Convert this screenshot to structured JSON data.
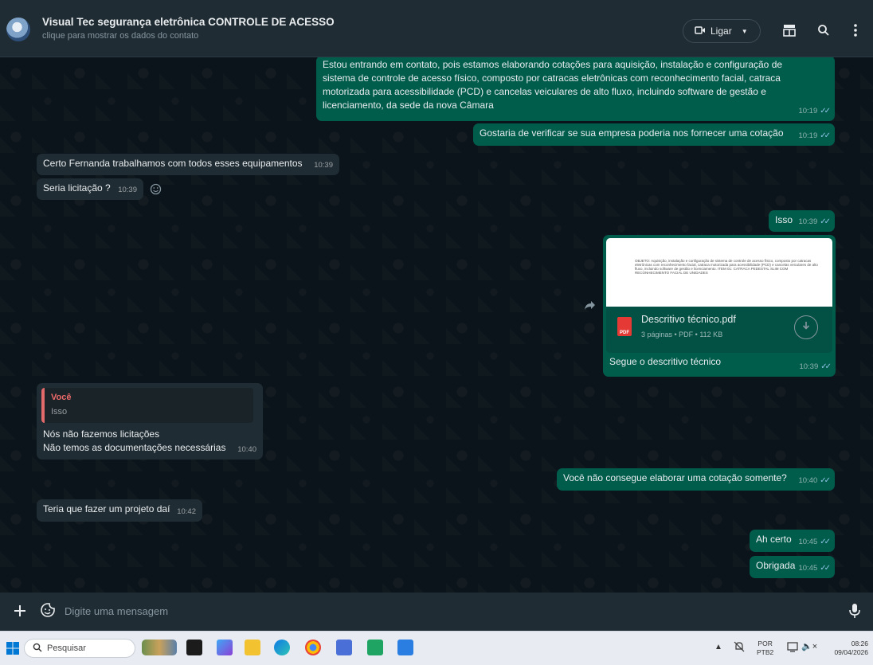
{
  "header": {
    "contact_name": "Visual Tec segurança eletrônica CONTROLE DE ACESSO",
    "contact_subtitle": "clique para mostrar os dados do contato",
    "call_label": "Ligar"
  },
  "messages": {
    "m1": {
      "text": "Estou entrando em contato, pois estamos elaborando cotações para aquisição, instalação e configuração de sistema de controle de acesso físico, composto por catracas eletrônicas com reconhecimento facial, catraca motorizada para acessibilidade (PCD) e cancelas veiculares de alto fluxo, incluindo software de gestão e licenciamento, da sede da nova Câmara",
      "time": "10:19"
    },
    "m2": {
      "text": "Gostaria de verificar se sua empresa poderia nos fornecer uma cotação",
      "time": "10:19"
    },
    "m3": {
      "text": "Certo Fernanda trabalhamos com todos esses equipamentos",
      "time": "10:39"
    },
    "m4": {
      "text": "Seria licitação ?",
      "time": "10:39"
    },
    "m5": {
      "text": "Isso",
      "time": "10:39"
    },
    "m6": {
      "preview_text": "OBJETO: Aquisição, instalação e configuração de sistema de controle de acesso físico, composto por catracas eletrônicas com reconhecimento facial, catraca motorizada para acessibilidade (PCD) e cancelas veiculares de alto fluxo, incluindo software de gestão e licenciamento. ITEM 01: CATRACA PEDESTAL SLIM COM RECONHECIMENTO FACIAL DE UNIDADES",
      "file_name": "Descritivo técnico.pdf",
      "file_meta": "3 páginas • PDF • 112 KB",
      "pdf_label": "PDF",
      "caption": "Segue o descritivo técnico",
      "time": "10:39"
    },
    "m7": {
      "quote_author": "Você",
      "quote_text": "Isso",
      "line1": "Nós não fazemos licitações",
      "line2": "Não temos as documentações necessárias",
      "time": "10:40"
    },
    "m8": {
      "text": "Você não consegue elaborar uma cotação somente?",
      "time": "10:40"
    },
    "m9": {
      "text": "Teria que fazer um projeto daí",
      "time": "10:42"
    },
    "m10": {
      "text": "Ah certo",
      "time": "10:45"
    },
    "m11": {
      "text": "Obrigada",
      "time": "10:45"
    }
  },
  "composer": {
    "placeholder": "Digite uma mensagem"
  },
  "taskbar": {
    "search_placeholder": "Pesquisar",
    "lang_line1": "POR",
    "lang_line2": "PTB2",
    "clock_time": "08:26",
    "clock_date": "09/04/2026"
  },
  "colors": {
    "outgoing_bubble": "#005c4b",
    "incoming_bubble": "#202c33",
    "chat_background": "#0b141a",
    "read_ticks": "#8ec3e6"
  }
}
